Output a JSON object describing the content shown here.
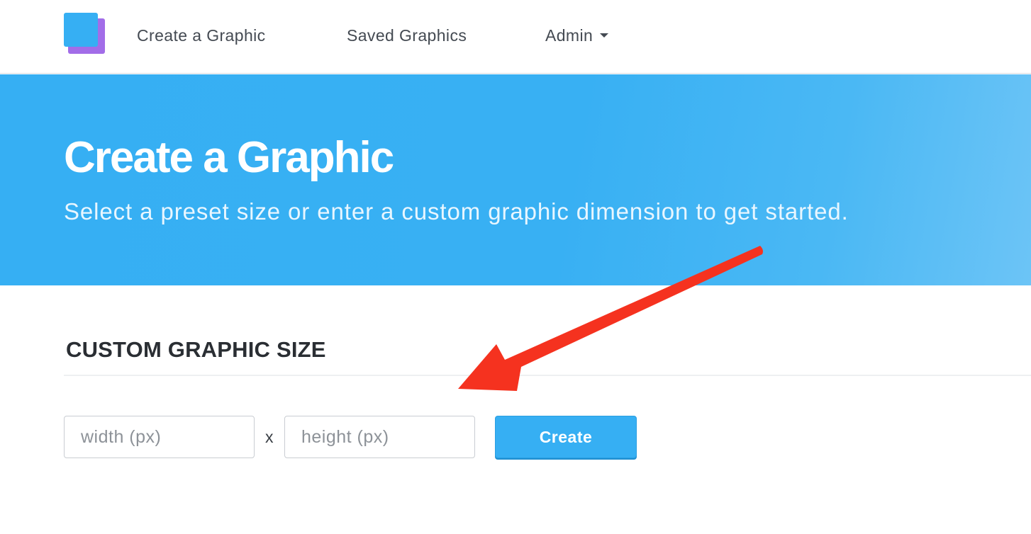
{
  "nav": {
    "logo_icon": "layered-squares-logo",
    "items": [
      {
        "label": "Create a Graphic"
      },
      {
        "label": "Saved Graphics"
      },
      {
        "label": "Admin",
        "icon": "chevron-down-icon"
      }
    ]
  },
  "hero": {
    "title": "Create a Graphic",
    "subtitle": "Select a preset size or enter a custom graphic dimension to get started."
  },
  "custom_size": {
    "heading": "CUSTOM GRAPHIC SIZE",
    "width_placeholder": "width (px)",
    "width_value": "",
    "separator": "x",
    "height_placeholder": "height (px)",
    "height_value": "",
    "create_label": "Create"
  },
  "colors": {
    "accent": "#36aff3",
    "logo_back": "#a26de8",
    "annotation_arrow": "#f5321f"
  }
}
